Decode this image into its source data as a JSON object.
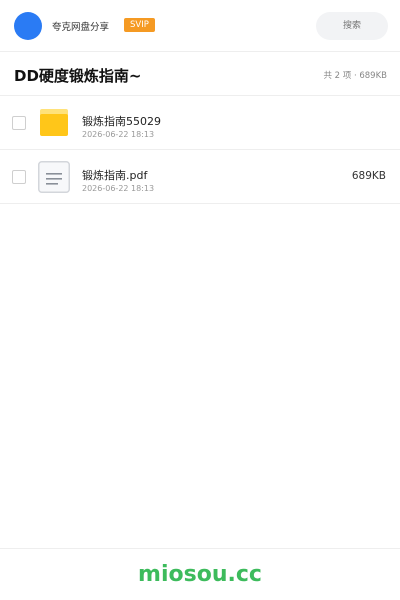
{
  "header": {
    "app_name": "夸克网盘分享",
    "badge": "SVIP",
    "search_placeholder": "搜索"
  },
  "folder": {
    "title": "DD硬度锻炼指南~",
    "summary": "共 2 项 · 689KB"
  },
  "files": [
    {
      "name": "锻炼指南55029",
      "date": "2026-06-22 18:13",
      "size": "",
      "icon": "folder-icon"
    },
    {
      "name": "锻炼指南.pdf",
      "date": "2026-06-22 18:13",
      "size": "689KB",
      "icon": "document-icon"
    }
  ],
  "footer": {
    "brand": "miosou.cc"
  },
  "colors": {
    "accent": "#2a7bf4",
    "badge": "#f59a23",
    "folder": "#ffc619",
    "brand": "#3dbb5c"
  }
}
